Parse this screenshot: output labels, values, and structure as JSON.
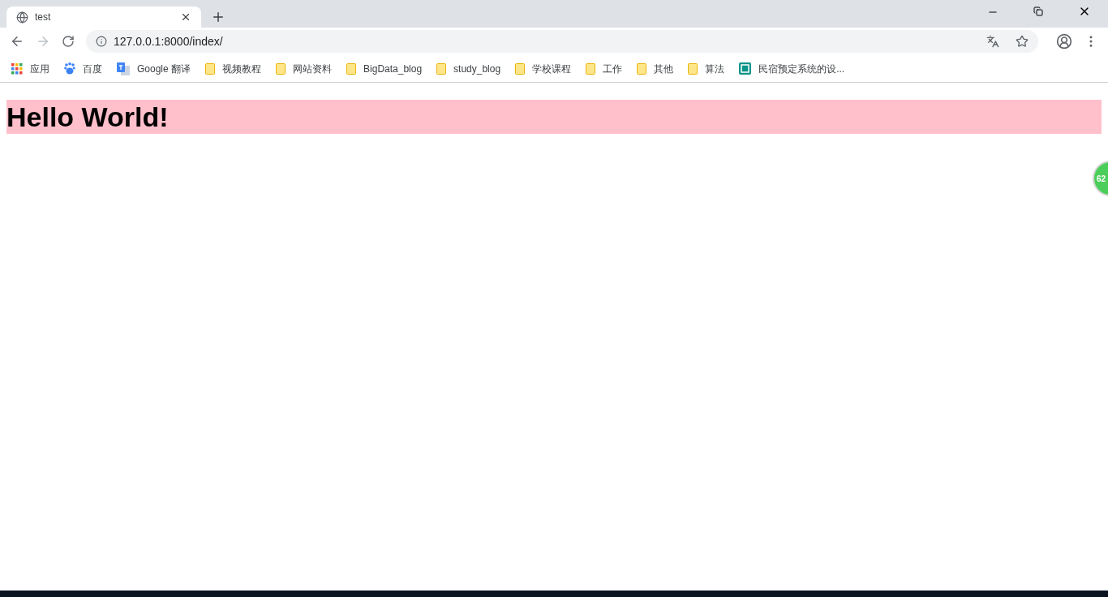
{
  "tab": {
    "title": "test",
    "selected": true
  },
  "address_bar": {
    "url": "127.0.0.1:8000/index/"
  },
  "bookmarks": [
    {
      "kind": "apps",
      "label": "应用"
    },
    {
      "kind": "paw",
      "label": "百度"
    },
    {
      "kind": "translate",
      "label": "Google 翻译"
    },
    {
      "kind": "folder",
      "label": "视频教程"
    },
    {
      "kind": "folder",
      "label": "网站资料"
    },
    {
      "kind": "folder",
      "label": "BigData_blog"
    },
    {
      "kind": "folder",
      "label": "study_blog"
    },
    {
      "kind": "folder",
      "label": "学校课程"
    },
    {
      "kind": "folder",
      "label": "工作"
    },
    {
      "kind": "folder",
      "label": "其他"
    },
    {
      "kind": "folder",
      "label": "算法"
    },
    {
      "kind": "site",
      "label": "民宿预定系统的设..."
    }
  ],
  "page": {
    "heading": "Hello World!"
  },
  "floating_ball": {
    "text": "62"
  }
}
